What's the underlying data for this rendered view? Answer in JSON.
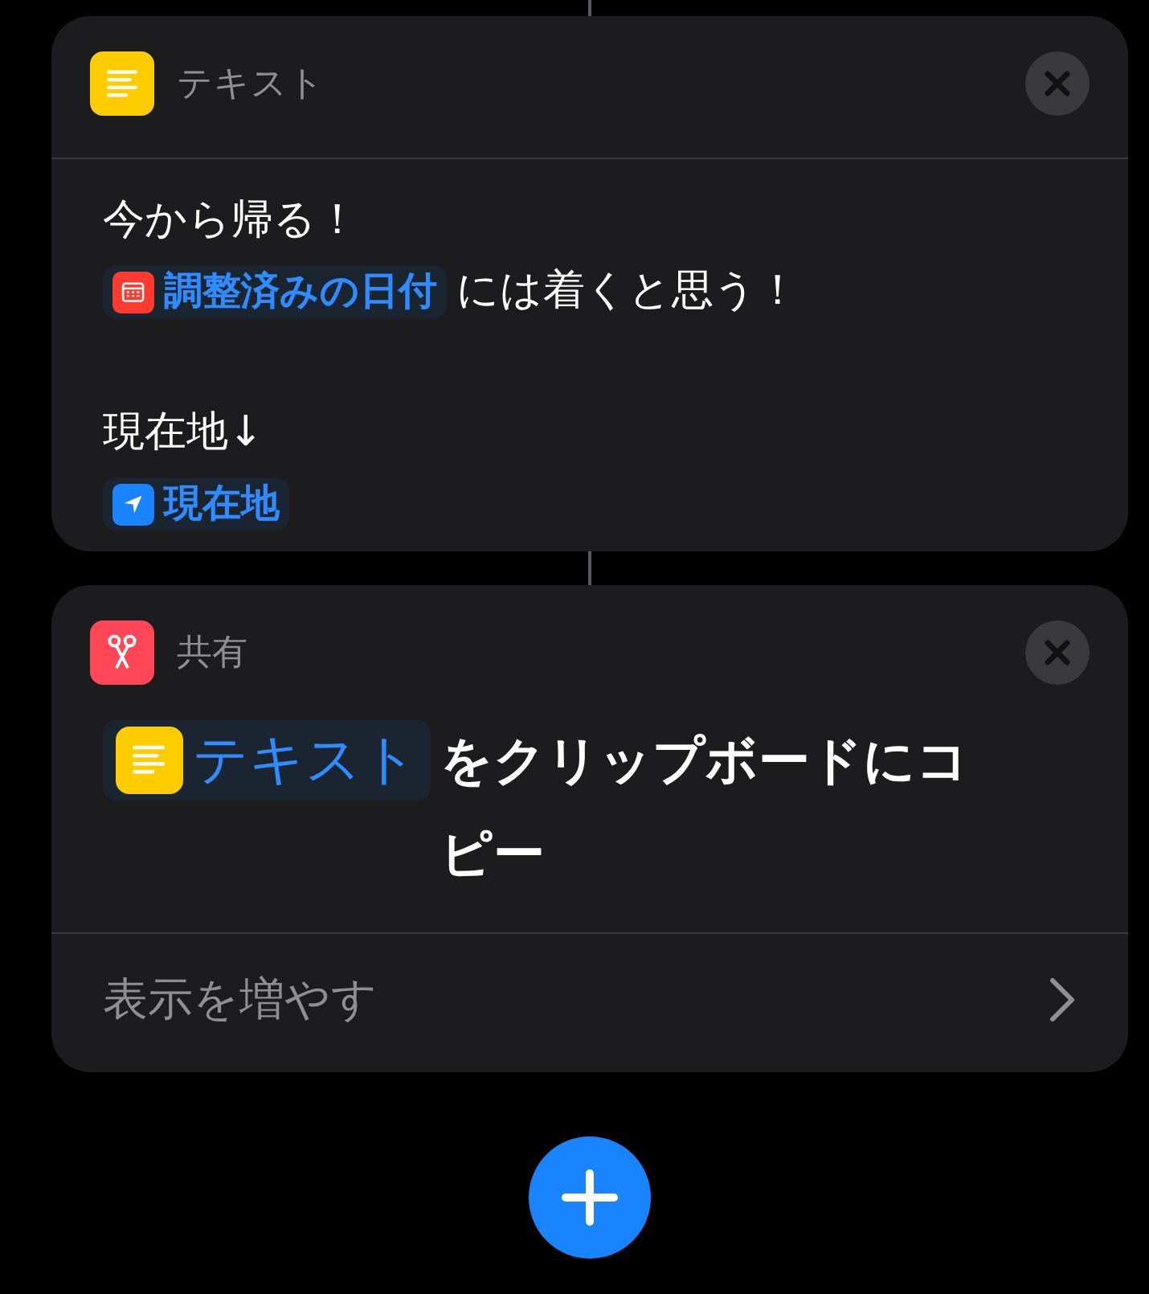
{
  "actions": [
    {
      "kind": "text",
      "title": "テキスト",
      "paragraphs": [
        {
          "lines": [
            [
              {
                "kind": "plain",
                "text": "今から帰る！"
              }
            ],
            [
              {
                "kind": "date",
                "text": "調整済みの日付"
              },
              {
                "kind": "plain",
                "text": "には着くと思う！"
              }
            ]
          ]
        },
        {
          "lines": [
            [
              {
                "kind": "plain",
                "text": "現在地↓"
              }
            ],
            [
              {
                "kind": "location",
                "text": "現在地"
              }
            ]
          ]
        }
      ]
    },
    {
      "kind": "share",
      "title": "共有",
      "sentence": [
        {
          "kind": "text",
          "text": "テキスト"
        },
        {
          "kind": "plain",
          "text": "をクリップボードにコピー"
        }
      ],
      "more": "表示を増やす"
    }
  ]
}
